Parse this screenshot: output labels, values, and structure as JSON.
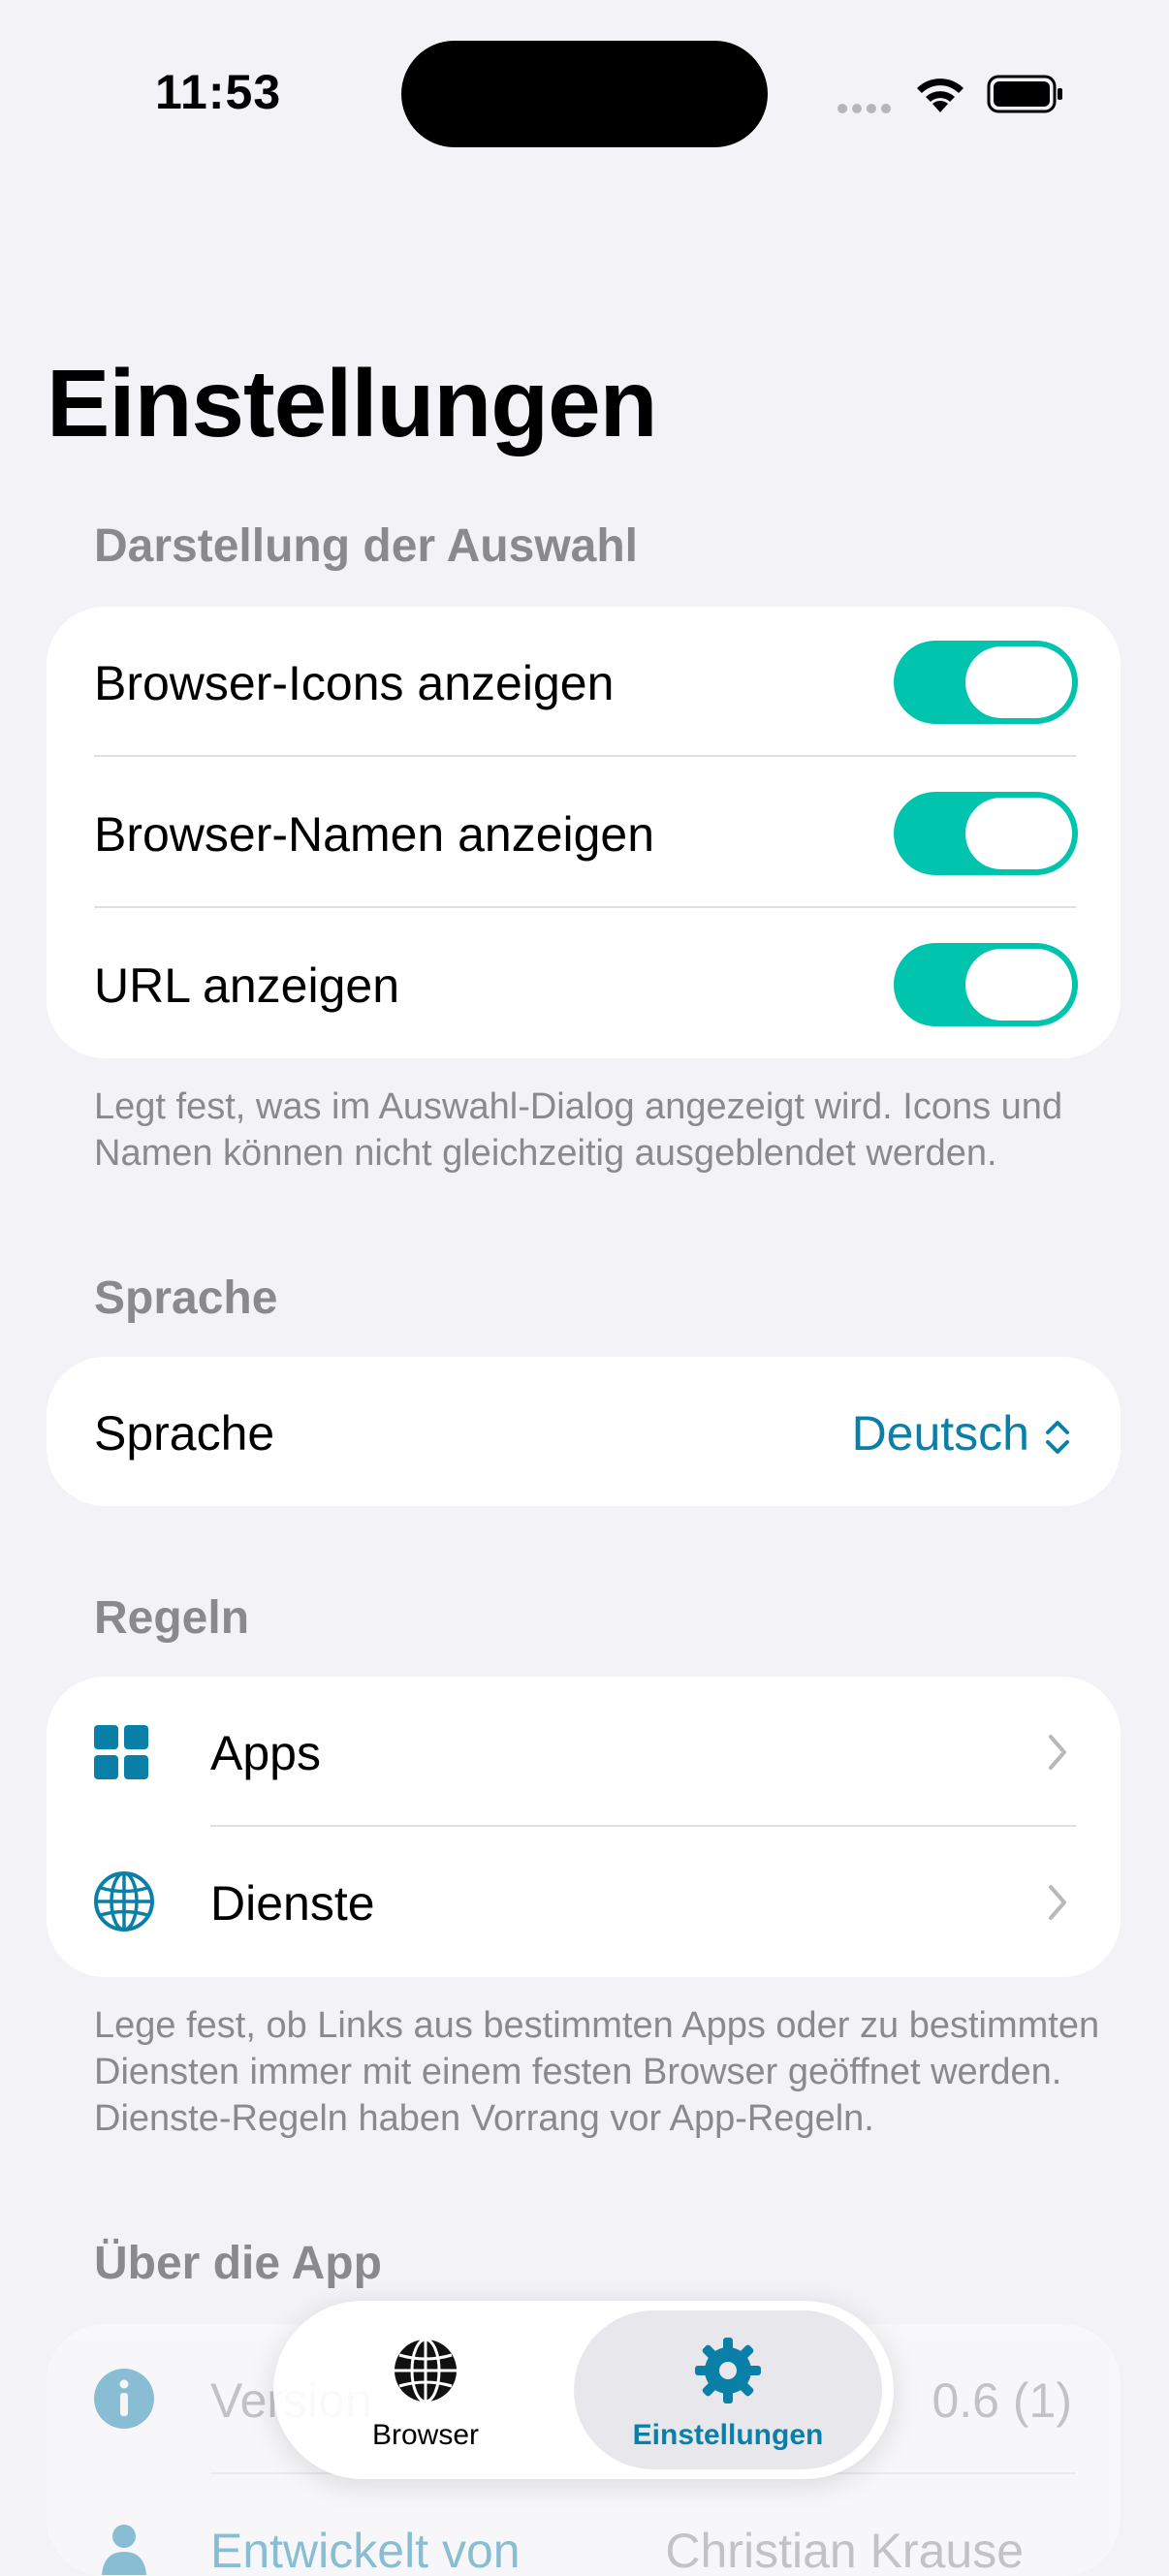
{
  "status_bar": {
    "time": "11:53"
  },
  "page": {
    "title": "Einstellungen"
  },
  "display_section": {
    "header": "Darstellung der Auswahl",
    "rows": [
      {
        "label": "Browser-Icons anzeigen",
        "on": true
      },
      {
        "label": "Browser-Namen anzeigen",
        "on": true
      },
      {
        "label": "URL anzeigen",
        "on": true
      }
    ],
    "footer": "Legt fest, was im Auswahl-Dialog angezeigt wird. Icons und Namen können nicht gleichzeitig ausgeblendet werden."
  },
  "language_section": {
    "header": "Sprache",
    "row_label": "Sprache",
    "value": "Deutsch"
  },
  "rules_section": {
    "header": "Regeln",
    "rows": [
      {
        "label": "Apps",
        "icon": "grid-icon"
      },
      {
        "label": "Dienste",
        "icon": "globe-icon"
      }
    ],
    "footer": "Lege fest, ob Links aus bestimmten Apps oder zu bestimmten Diensten immer mit einem festen Browser geöffnet werden. Dienste-Regeln haben Vorrang vor App-Regeln."
  },
  "about_section": {
    "header": "Über die App",
    "version_label": "Version",
    "version_value": "0.6 (1)",
    "developer_label": "Entwickelt von",
    "developer_value": "Christian Krause"
  },
  "tab_bar": {
    "tabs": [
      {
        "label": "Browser",
        "icon": "globe-icon",
        "selected": false
      },
      {
        "label": "Einstellungen",
        "icon": "gear-icon",
        "selected": true
      }
    ]
  },
  "colors": {
    "accent": "#0a7fa8",
    "toggle_on": "#00c4ad",
    "secondary_text": "#8a8a8e"
  }
}
